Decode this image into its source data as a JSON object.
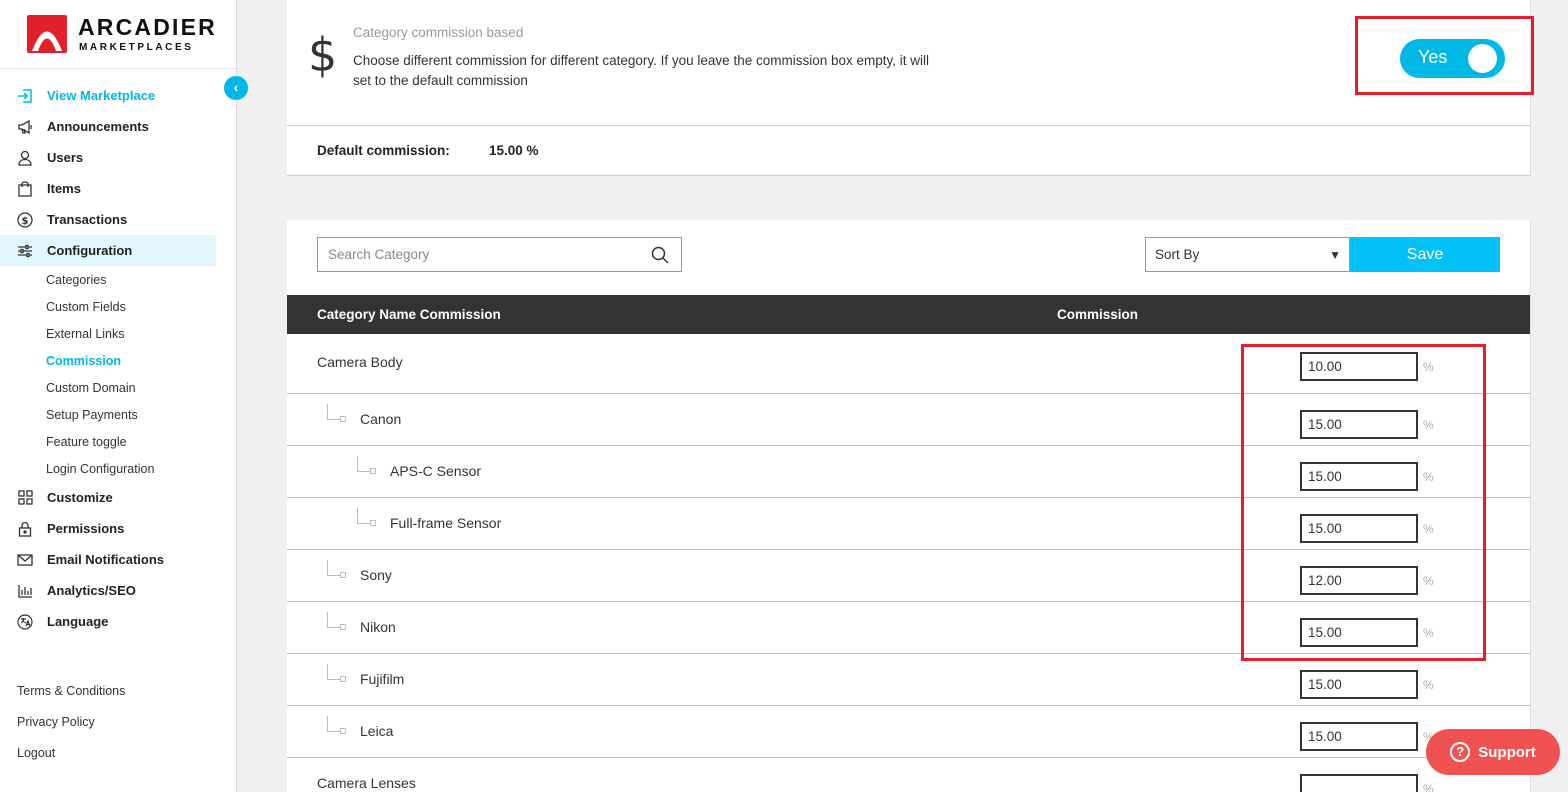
{
  "brand": {
    "title": "ARCADIER",
    "subtitle": "MARKETPLACES",
    "accent": "#00b8e6",
    "logo_color": "#e0202a"
  },
  "sidebar": {
    "items": [
      {
        "label": "View Marketplace",
        "icon": "login-arrow-icon",
        "state": "link-active"
      },
      {
        "label": "Announcements",
        "icon": "megaphone-icon"
      },
      {
        "label": "Users",
        "icon": "user-icon"
      },
      {
        "label": "Items",
        "icon": "shopping-bag-icon"
      },
      {
        "label": "Transactions",
        "icon": "dollar-circle-icon"
      },
      {
        "label": "Configuration",
        "icon": "sliders-icon",
        "state": "selected"
      }
    ],
    "config_subitems": [
      "Categories",
      "Custom Fields",
      "External Links",
      "Commission",
      "Custom Domain",
      "Setup Payments",
      "Feature toggle",
      "Login Configuration"
    ],
    "active_subitem": "Commission",
    "items_after": [
      {
        "label": "Customize",
        "icon": "grid-icon"
      },
      {
        "label": "Permissions",
        "icon": "lock-icon"
      },
      {
        "label": "Email Notifications",
        "icon": "envelope-icon"
      },
      {
        "label": "Analytics/SEO",
        "icon": "bar-chart-icon"
      },
      {
        "label": "Language",
        "icon": "translate-icon"
      }
    ],
    "footer_links": [
      "Terms & Conditions",
      "Privacy Policy",
      "Logout"
    ]
  },
  "commission_settings": {
    "title": "Category commission based",
    "description": "Choose different commission for different category. If you leave the commission box empty, it will set to the default commission",
    "toggle_label": "Yes",
    "toggle_on": true,
    "default_label": "Default commission:",
    "default_value": "15.00 %"
  },
  "table": {
    "search_placeholder": "Search Category",
    "sort_label": "Sort By",
    "save_label": "Save",
    "headers": {
      "name": "Category Name Commission",
      "commission": "Commission"
    },
    "percent_symbol": "%",
    "rows": [
      {
        "name": "Camera Body",
        "level": 0,
        "commission": "10.00"
      },
      {
        "name": "Canon",
        "level": 1,
        "commission": "15.00"
      },
      {
        "name": "APS-C Sensor",
        "level": 2,
        "commission": "15.00"
      },
      {
        "name": "Full-frame Sensor",
        "level": 2,
        "commission": "15.00"
      },
      {
        "name": "Sony",
        "level": 1,
        "commission": "12.00"
      },
      {
        "name": "Nikon",
        "level": 1,
        "commission": "15.00"
      },
      {
        "name": "Fujifilm",
        "level": 1,
        "commission": "15.00"
      },
      {
        "name": "Leica",
        "level": 1,
        "commission": "15.00"
      },
      {
        "name": "Camera Lenses",
        "level": 0,
        "commission": ""
      }
    ]
  },
  "support": {
    "label": "Support",
    "color": "#f05252"
  }
}
